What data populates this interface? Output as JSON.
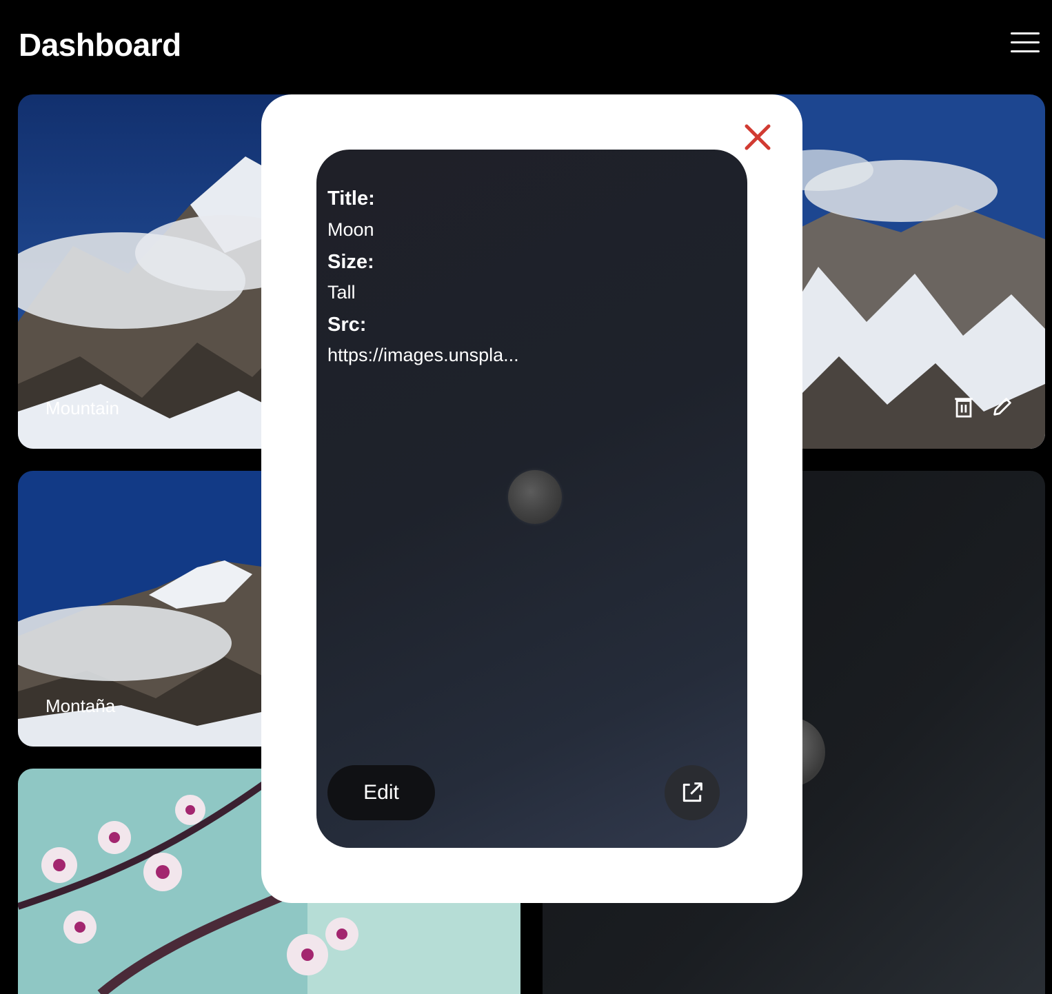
{
  "header": {
    "title": "Dashboard",
    "menu_icon": "hamburger-menu-icon"
  },
  "gallery": {
    "cards": [
      {
        "label": "Mountain",
        "image": "snowy-mountain-clouds"
      },
      {
        "label": "",
        "image": "snowy-mountain-peaks"
      },
      {
        "label": "Montaña",
        "image": "snowy-mountain-clouds"
      },
      {
        "label": "",
        "image": "moon-night-sky"
      },
      {
        "label": "",
        "image": "pink-blossoms"
      }
    ],
    "actions": {
      "delete_icon": "trash-icon",
      "edit_icon": "pencil-icon"
    }
  },
  "modal": {
    "close_icon": "close-icon",
    "close_color": "#d13b32",
    "details": {
      "title_label": "Title:",
      "title_value": "Moon",
      "size_label": "Size:",
      "size_value": "Tall",
      "src_label": "Src:",
      "src_value": "https://images.unspla..."
    },
    "edit_label": "Edit",
    "open_icon": "external-link-icon"
  }
}
